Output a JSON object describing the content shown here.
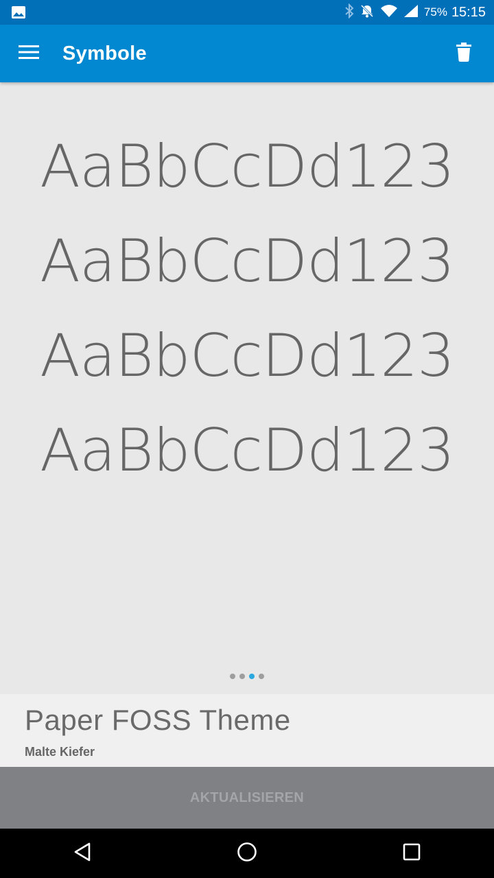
{
  "status_bar": {
    "icons": [
      "image-icon",
      "bluetooth-icon",
      "notifications-off-icon",
      "wifi-icon",
      "signal-icon"
    ],
    "battery": "75%",
    "time": "15:15",
    "background": "#0270b9"
  },
  "app_bar": {
    "title": "Symbole",
    "background": "#0288d1",
    "menu_icon": "menu-icon",
    "action_icon": "delete-icon"
  },
  "preview": {
    "lines": [
      "AaBbCcDd123",
      "AaBbCcDd123",
      "AaBbCcDd123",
      "AaBbCcDd123"
    ],
    "text_color": "#666666"
  },
  "pager": {
    "count": 4,
    "active_index": 2,
    "active_color": "#29a9e0"
  },
  "theme": {
    "name": "Paper FOSS Theme",
    "author": "Malte Kiefer"
  },
  "update_button": {
    "label": "AKTUALISIEREN"
  },
  "nav_bar": {
    "icons": [
      "back-icon",
      "home-icon",
      "recents-icon"
    ]
  }
}
